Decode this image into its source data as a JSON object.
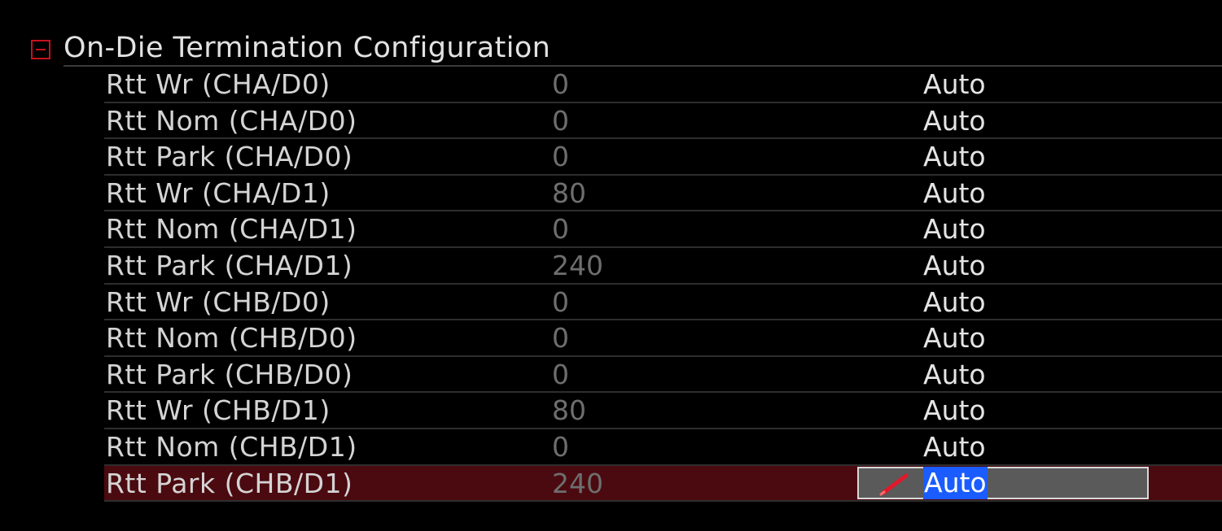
{
  "section": {
    "title": "On-Die Termination Configuration",
    "collapse_icon": "minus-box-icon",
    "accent_color": "#c8101e"
  },
  "rows": [
    {
      "label": "Rtt Wr (CHA/D0)",
      "current": "0",
      "setting": "Auto"
    },
    {
      "label": "Rtt Nom (CHA/D0)",
      "current": "0",
      "setting": "Auto"
    },
    {
      "label": "Rtt Park (CHA/D0)",
      "current": "0",
      "setting": "Auto"
    },
    {
      "label": "Rtt Wr (CHA/D1)",
      "current": "80",
      "setting": "Auto"
    },
    {
      "label": "Rtt Nom (CHA/D1)",
      "current": "0",
      "setting": "Auto"
    },
    {
      "label": "Rtt Park (CHA/D1)",
      "current": "240",
      "setting": "Auto"
    },
    {
      "label": "Rtt Wr (CHB/D0)",
      "current": "0",
      "setting": "Auto"
    },
    {
      "label": "Rtt Nom (CHB/D0)",
      "current": "0",
      "setting": "Auto"
    },
    {
      "label": "Rtt Park (CHB/D0)",
      "current": "0",
      "setting": "Auto"
    },
    {
      "label": "Rtt Wr (CHB/D1)",
      "current": "80",
      "setting": "Auto"
    },
    {
      "label": "Rtt Nom (CHB/D1)",
      "current": "0",
      "setting": "Auto"
    },
    {
      "label": "Rtt Park (CHB/D1)",
      "current": "240",
      "setting": "Auto"
    }
  ],
  "selected_row_index": 11,
  "colors": {
    "selected_row_bg": "#4a0a10",
    "edit_box_bg": "#5a5a5a",
    "text_highlight": "#1a5cff",
    "current_value_text": "#6e6e6e"
  },
  "icons": {
    "edit": "pencil-icon"
  }
}
